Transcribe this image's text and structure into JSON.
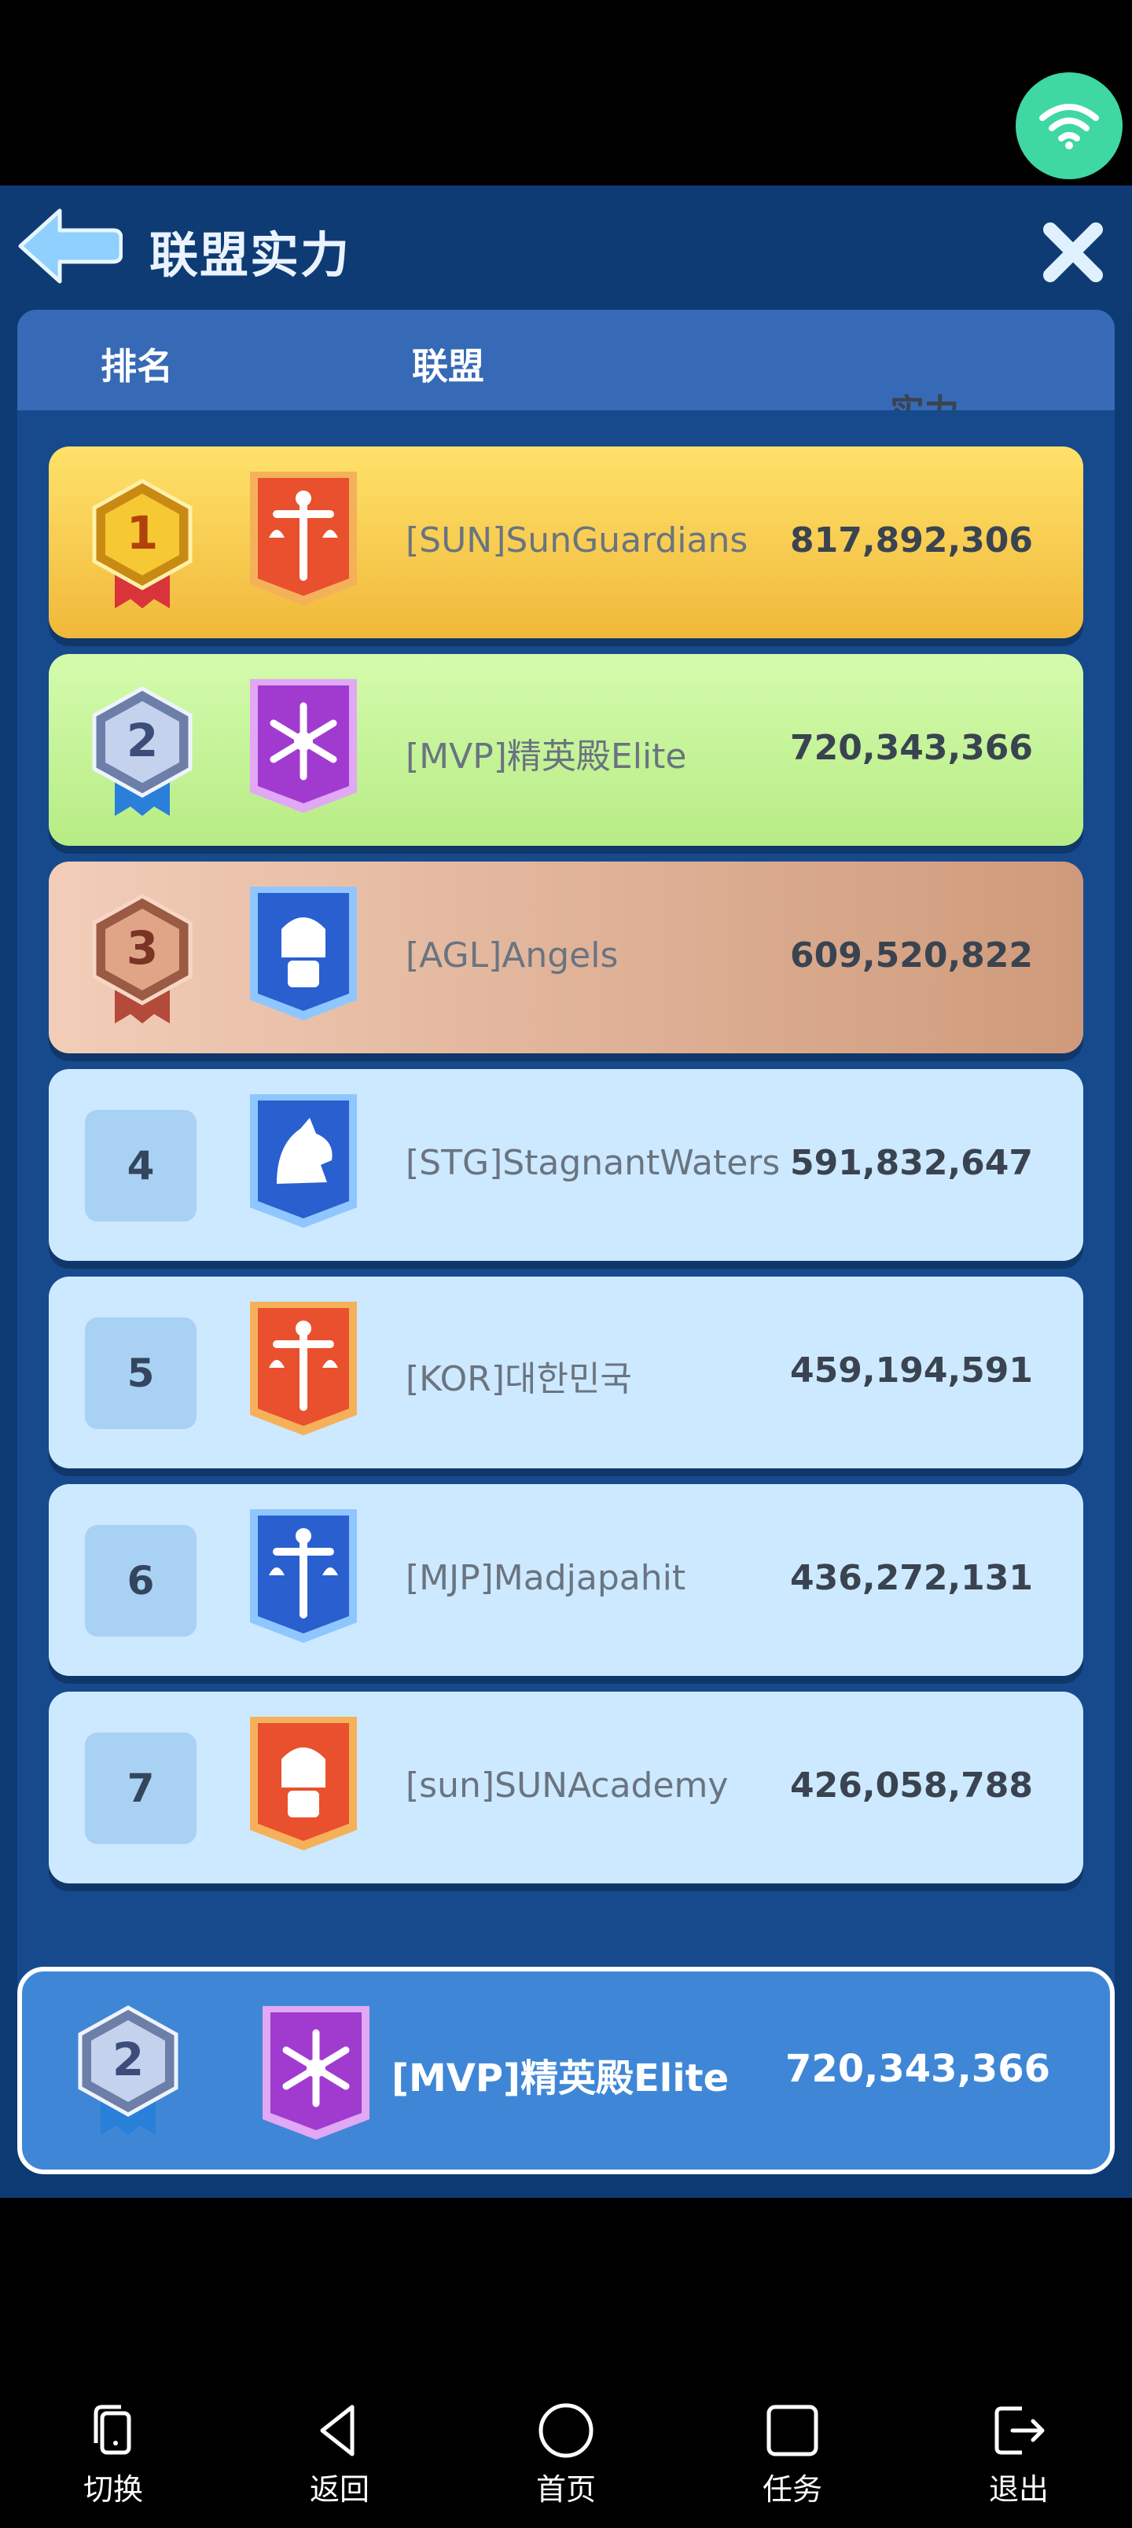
{
  "page": {
    "title": "联盟实力"
  },
  "table": {
    "headers": {
      "rank": "排名",
      "alliance": "联盟",
      "power": "实力"
    }
  },
  "rows": [
    {
      "rank": "1",
      "name": "[SUN]SunGuardians",
      "power": "817,892,306",
      "style": "gold",
      "banner_color": "#e9502e",
      "emblem": "sword-scales-icon"
    },
    {
      "rank": "2",
      "name": "[MVP]精英殿Elite",
      "power": "720,343,366",
      "style": "green",
      "banner_color": "#a13bd0",
      "emblem": "snowflake-icon"
    },
    {
      "rank": "3",
      "name": "[AGL]Angels",
      "power": "609,520,822",
      "style": "bronze",
      "banner_color": "#2a5fd0",
      "emblem": "gauntlet-icon"
    },
    {
      "rank": "4",
      "name": "[STG]StagnantWaters",
      "power": "591,832,647",
      "style": "plain",
      "banner_color": "#2a5fd0",
      "emblem": "wolf-icon"
    },
    {
      "rank": "5",
      "name": "[KOR]대한민국",
      "power": "459,194,591",
      "style": "plain",
      "banner_color": "#e9502e",
      "emblem": "sword-scales-icon"
    },
    {
      "rank": "6",
      "name": "[MJP]Madjapahit",
      "power": "436,272,131",
      "style": "plain",
      "banner_color": "#2a5fd0",
      "emblem": "sword-scales-icon"
    },
    {
      "rank": "7",
      "name": "[sun]SUNAcademy",
      "power": "426,058,788",
      "style": "plain",
      "banner_color": "#e9502e",
      "emblem": "gauntlet-icon"
    }
  ],
  "my_alliance": {
    "rank": "2",
    "name": "[MVP]精英殿Elite",
    "power": "720,343,366"
  },
  "nav": [
    {
      "label": "切换",
      "icon": "switch-device-icon"
    },
    {
      "label": "返回",
      "icon": "back-triangle-icon"
    },
    {
      "label": "首页",
      "icon": "home-circle-icon"
    },
    {
      "label": "任务",
      "icon": "tasks-square-icon"
    },
    {
      "label": "退出",
      "icon": "exit-icon"
    }
  ]
}
